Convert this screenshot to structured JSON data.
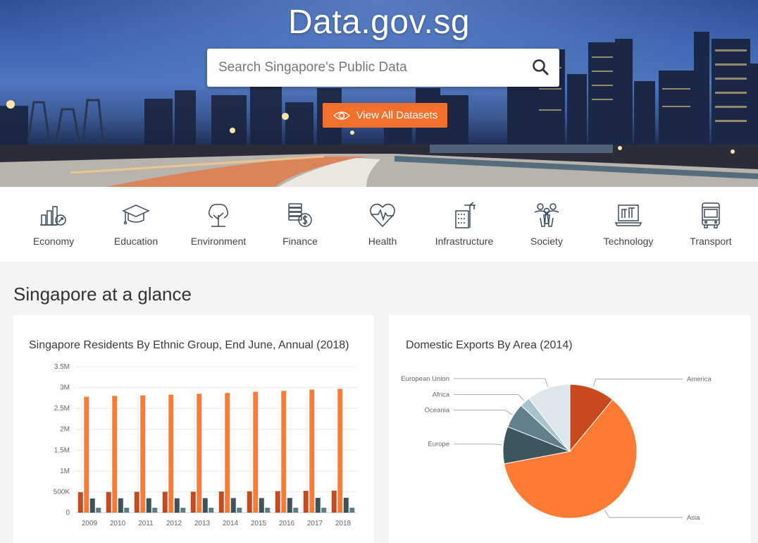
{
  "hero": {
    "title": "Data.gov.sg",
    "search_placeholder": "Search Singapore's Public Data",
    "view_all_label": "View All Datasets"
  },
  "categories": [
    {
      "label": "Economy",
      "icon": "economy-chart-icon"
    },
    {
      "label": "Education",
      "icon": "graduation-cap-icon"
    },
    {
      "label": "Environment",
      "icon": "tree-icon"
    },
    {
      "label": "Finance",
      "icon": "coins-dollar-icon"
    },
    {
      "label": "Health",
      "icon": "heart-pulse-icon"
    },
    {
      "label": "Infrastructure",
      "icon": "building-crane-icon"
    },
    {
      "label": "Society",
      "icon": "people-icon"
    },
    {
      "label": "Technology",
      "icon": "laptop-icon"
    },
    {
      "label": "Transport",
      "icon": "bus-icon"
    }
  ],
  "section_title": "Singapore at a glance",
  "colors": {
    "accent": "#f2702c",
    "series": [
      "#c9491f",
      "#ff7a33",
      "#3b5359",
      "#5f7d86"
    ],
    "pie": [
      "#c9491f",
      "#ff7a33",
      "#3d555c",
      "#62808a",
      "#a9c3cc",
      "#dde6ea"
    ]
  },
  "chart_data": [
    {
      "type": "bar",
      "title": "Singapore Residents By Ethnic Group, End June, Annual (2018)",
      "categories": [
        "2009",
        "2010",
        "2011",
        "2012",
        "2013",
        "2014",
        "2015",
        "2016",
        "2017",
        "2018"
      ],
      "ylim": [
        0,
        3500000
      ],
      "yticks": [
        {
          "value": 0,
          "label": "0"
        },
        {
          "value": 500000,
          "label": "500K"
        },
        {
          "value": 1000000,
          "label": "1M"
        },
        {
          "value": 1500000,
          "label": "1.5M"
        },
        {
          "value": 2000000,
          "label": "2M"
        },
        {
          "value": 2500000,
          "label": "2.5M"
        },
        {
          "value": 3000000,
          "label": "3M"
        },
        {
          "value": 3500000,
          "label": "3.5M"
        }
      ],
      "grid": true,
      "series": [
        {
          "values": [
            490000,
            495000,
            500000,
            500000,
            503000,
            507000,
            512000,
            517000,
            525000,
            530000
          ]
        },
        {
          "values": [
            2780000,
            2800000,
            2810000,
            2830000,
            2850000,
            2870000,
            2900000,
            2920000,
            2950000,
            2970000
          ]
        },
        {
          "values": [
            340000,
            345000,
            345000,
            345000,
            348000,
            350000,
            350000,
            352000,
            355000,
            358000
          ]
        },
        {
          "values": [
            120000,
            120000,
            120000,
            120000,
            120000,
            120000,
            120000,
            120000,
            120000,
            120000
          ]
        }
      ]
    },
    {
      "type": "pie",
      "title": "Domestic Exports By Area (2014)",
      "slices": [
        {
          "label": "America",
          "value": 11
        },
        {
          "label": "Asia",
          "value": 61
        },
        {
          "label": "Europe",
          "value": 9
        },
        {
          "label": "Oceania",
          "value": 6
        },
        {
          "label": "Africa",
          "value": 2.5
        },
        {
          "label": "European Union",
          "value": 10.5
        }
      ]
    }
  ]
}
